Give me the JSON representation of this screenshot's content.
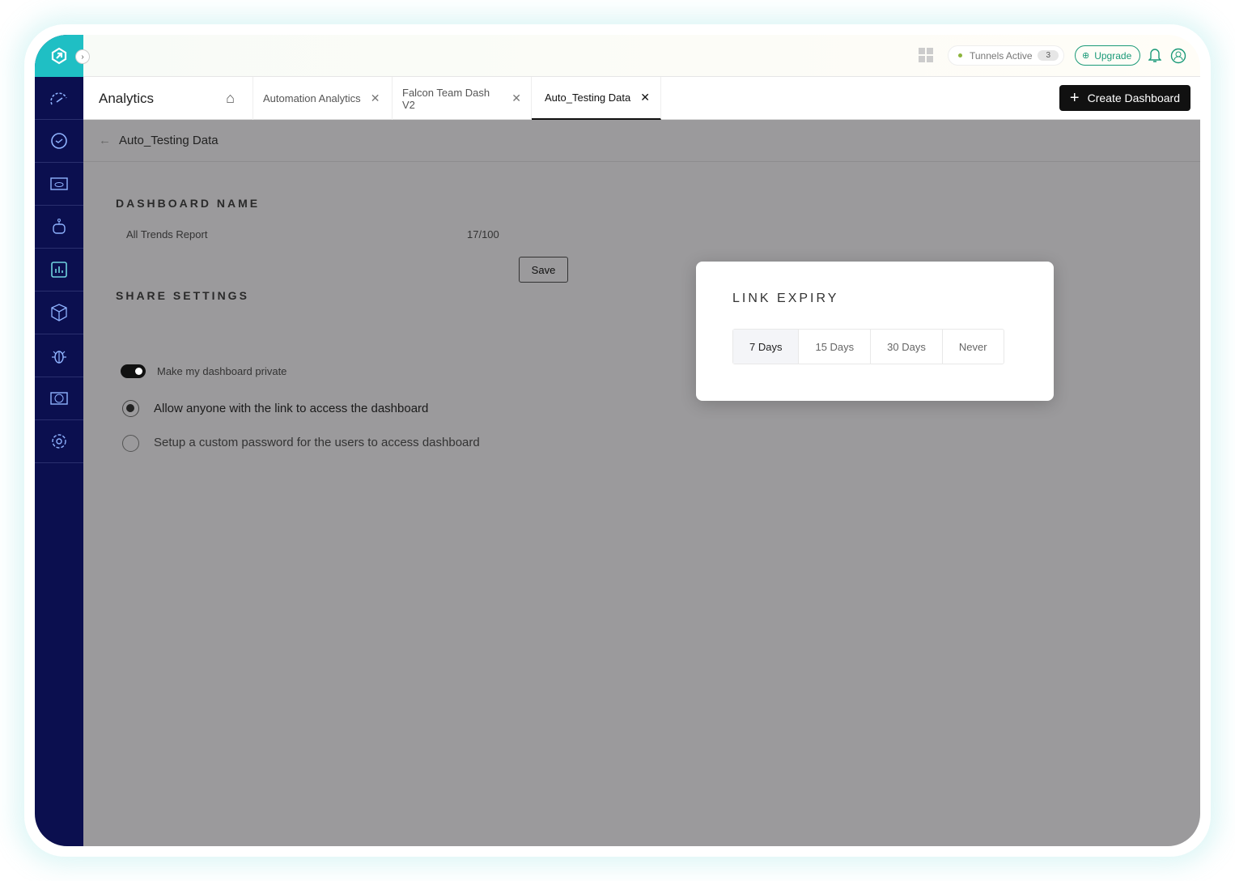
{
  "topbar": {
    "tunnels_label": "Tunnels Active",
    "tunnels_count": "3",
    "upgrade_label": "Upgrade"
  },
  "sidebar": {
    "items": [
      "dashboard-icon",
      "history-icon",
      "web-preview-icon",
      "robot-icon",
      "analytics-icon",
      "package-icon",
      "bug-icon",
      "visual-compare-icon",
      "settings-icon"
    ]
  },
  "header": {
    "title": "Analytics",
    "tabs": [
      {
        "label": "Automation Analytics"
      },
      {
        "label": "Falcon Team Dash V2"
      },
      {
        "label": "Auto_Testing Data",
        "active": true
      }
    ],
    "create_label": "Create Dashboard"
  },
  "breadcrumb": {
    "title": "Auto_Testing Data"
  },
  "dashboard_name": {
    "heading": "DASHBOARD NAME",
    "value": "All Trends Report",
    "counter": "17/100",
    "save_label": "Save"
  },
  "share": {
    "heading": "SHARE SETTINGS",
    "private_label": "Make my dashboard private",
    "private_on": true,
    "options": [
      {
        "label": "Allow anyone with the link to access the dashboard",
        "selected": true
      },
      {
        "label": "Setup a custom password for the users to access dashboard",
        "selected": false
      }
    ]
  },
  "link_expiry": {
    "heading": "LINK EXPIRY",
    "options": [
      "7 Days",
      "15 Days",
      "30 Days",
      "Never"
    ],
    "selected": "7 Days"
  },
  "colors": {
    "sidebar": "#0b0f4f",
    "logo": "#1fbfc4",
    "accent": "#1a9a78"
  }
}
